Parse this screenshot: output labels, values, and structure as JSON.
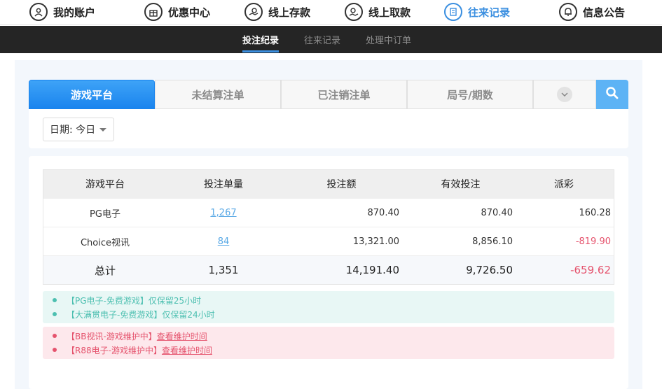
{
  "nav": {
    "items": [
      {
        "label": "我的账户",
        "icon": "user-icon"
      },
      {
        "label": "优惠中心",
        "icon": "gift-icon"
      },
      {
        "label": "线上存款",
        "icon": "deposit-icon"
      },
      {
        "label": "线上取款",
        "icon": "withdraw-icon"
      },
      {
        "label": "往来记录",
        "icon": "record-icon",
        "active": true
      },
      {
        "label": "信息公告",
        "icon": "bell-icon"
      }
    ],
    "active_color": "#3b8fe0"
  },
  "subnav": {
    "tabs": [
      "投注纪录",
      "往来记录",
      "处理中订单"
    ],
    "active_index": 0
  },
  "filter": {
    "tabs": [
      "游戏平台",
      "未结算注单",
      "已注销注单",
      "局号/期数"
    ],
    "active_index": 0,
    "date_label": "日期: 今日"
  },
  "table": {
    "headers": [
      "游戏平台",
      "投注单量",
      "投注额",
      "有效投注",
      "派彩"
    ],
    "rows": [
      {
        "platform": "PG电子",
        "count": "1,267",
        "amount": "870.40",
        "valid": "870.40",
        "payout": "160.28"
      },
      {
        "platform": "Choice视讯",
        "count": "84",
        "amount": "13,321.00",
        "valid": "8,856.10",
        "payout": "-819.90"
      }
    ],
    "total": {
      "label": "总计",
      "count": "1,351",
      "amount": "14,191.40",
      "valid": "9,726.50",
      "payout": "-659.62"
    }
  },
  "notices": {
    "green": [
      "【PG电子-免费游戏】仅保留25小时",
      "【大满贯电子-免费游戏】仅保留24小时"
    ],
    "red": [
      {
        "text": "【BB视讯-游戏维护中】",
        "link": "查看维护时间"
      },
      {
        "text": "【R88电子-游戏维护中】",
        "link": "查看维护时间"
      }
    ]
  },
  "colors": {
    "accent": "#1a84ee",
    "negative": "#e5536d",
    "notice_green": "#4cbfb0"
  }
}
